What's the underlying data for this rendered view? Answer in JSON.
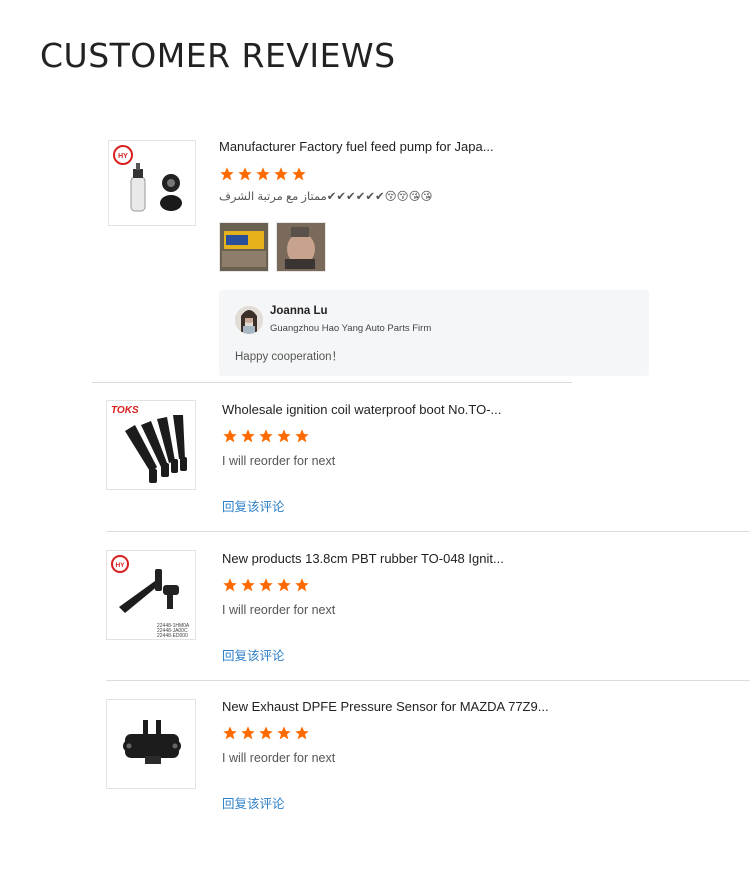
{
  "page": {
    "title": "CUSTOMER REVIEWS"
  },
  "colors": {
    "star": "#ff6a00",
    "link": "#2d7fc8",
    "seller_bg": "#f5f6f7"
  },
  "reviews": [
    {
      "product_title": "Manufacturer Factory fuel feed pump for Japa...",
      "rating": 5,
      "comment": "ممتاز مع مرتبة الشرف✔✔✔✔✔✔😚😚😘😘",
      "thumb_logo_text": "",
      "thumb_icon": "fuel-pump-image",
      "photos": [
        "review-photo-pump-box",
        "review-photo-hand"
      ],
      "seller_reply": {
        "name": "Joanna Lu",
        "company": "Guangzhou Hao Yang Auto Parts Firm",
        "message": "Happy cooperation！"
      }
    },
    {
      "product_title": "Wholesale ignition coil waterproof boot No.TO-...",
      "rating": 5,
      "comment": "I will reorder for next",
      "thumb_logo_text": "TOKS",
      "thumb_icon": "ignition-boots-image",
      "reply_link": "回复该评论"
    },
    {
      "product_title": "New products 13.8cm PBT rubber TO-048 Ignit...",
      "rating": 5,
      "comment": "I will reorder for next",
      "thumb_icon": "rubber-boot-image",
      "thumb_codes": [
        "22448-1HM0A",
        "22448-JA00C",
        "22448-ED000"
      ],
      "reply_link": "回复该评论"
    },
    {
      "product_title": "New Exhaust DPFE Pressure Sensor for MAZDA 77Z9...",
      "rating": 5,
      "comment": "I will reorder for next",
      "thumb_icon": "pressure-sensor-image",
      "reply_link": "回复该评论"
    }
  ]
}
